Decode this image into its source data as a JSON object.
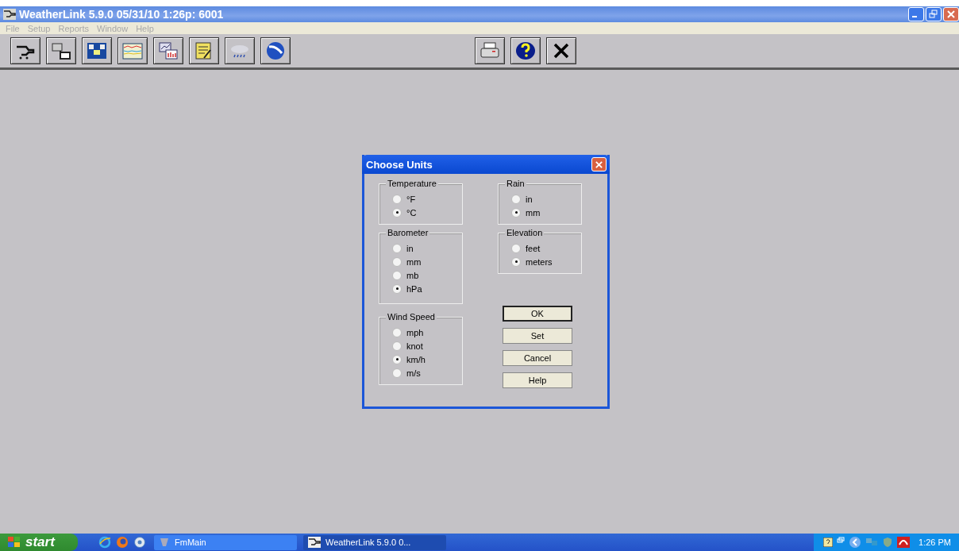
{
  "window": {
    "title": "WeatherLink 5.9.0  05/31/10   1:26p: 6001"
  },
  "menu": [
    "File",
    "Setup",
    "Reports",
    "Window",
    "Help"
  ],
  "dialog": {
    "title": "Choose Units",
    "left_column": [
      {
        "label": "Temperature",
        "options": [
          {
            "label": "°F",
            "selected": false
          },
          {
            "label": "°C",
            "selected": true
          }
        ]
      },
      {
        "label": "Barometer",
        "options": [
          {
            "label": "in",
            "selected": false
          },
          {
            "label": "mm",
            "selected": false
          },
          {
            "label": "mb",
            "selected": false
          },
          {
            "label": "hPa",
            "selected": true
          }
        ]
      },
      {
        "label": "Wind Speed",
        "options": [
          {
            "label": "mph",
            "selected": false
          },
          {
            "label": "knot",
            "selected": false
          },
          {
            "label": "km/h",
            "selected": true
          },
          {
            "label": "m/s",
            "selected": false
          }
        ]
      }
    ],
    "right_column": [
      {
        "label": "Rain",
        "options": [
          {
            "label": "in",
            "selected": false
          },
          {
            "label": "mm",
            "selected": true
          }
        ]
      },
      {
        "label": "Elevation",
        "options": [
          {
            "label": "feet",
            "selected": false
          },
          {
            "label": "meters",
            "selected": true
          }
        ]
      }
    ],
    "buttons": [
      {
        "label": "OK",
        "default": true
      },
      {
        "label": "Set",
        "default": false
      },
      {
        "label": "Cancel",
        "default": false
      },
      {
        "label": "Help",
        "default": false
      }
    ]
  },
  "taskbar": {
    "start": "start",
    "tasks": [
      {
        "label": "FmMain",
        "active": false
      },
      {
        "label": "WeatherLink 5.9.0  0...",
        "active": true
      }
    ],
    "clock": "1:26 PM"
  }
}
